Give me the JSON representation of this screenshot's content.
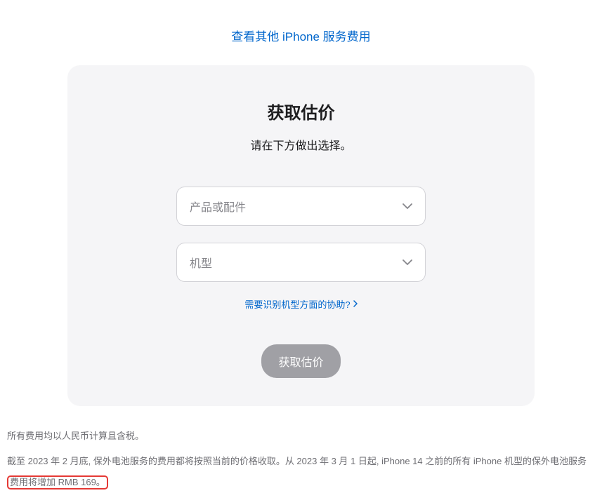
{
  "topLink": {
    "label": "查看其他 iPhone 服务费用"
  },
  "card": {
    "title": "获取估价",
    "subtitle": "请在下方做出选择。",
    "select1": {
      "placeholder": "产品或配件"
    },
    "select2": {
      "placeholder": "机型"
    },
    "helpLink": {
      "label": "需要识别机型方面的协助?"
    },
    "submit": {
      "label": "获取估价"
    }
  },
  "footer": {
    "line1": "所有费用均以人民币计算且含税。",
    "line2_part1": "截至 2023 年 2 月底, 保外电池服务的费用都将按照当前的价格收取。从 2023 年 3 月 1 日起, iPhone 14 之前的所有 iPhone 机型的保外电池服务",
    "line2_highlight": "费用将增加 RMB 169。"
  }
}
